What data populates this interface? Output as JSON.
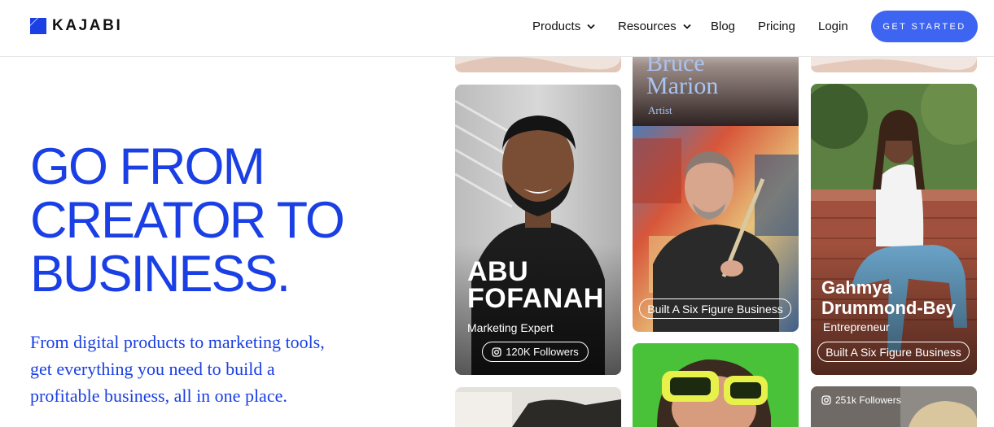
{
  "brand": {
    "name": "KAJABI",
    "color": "#1a3fe4"
  },
  "nav": {
    "items": [
      {
        "label": "Products"
      },
      {
        "label": "Resources"
      },
      {
        "label": "Blog"
      },
      {
        "label": "Pricing"
      },
      {
        "label": "Login"
      }
    ],
    "cta_label": "GET STARTED",
    "cta_color": "#3d65f1"
  },
  "hero": {
    "headline_lines": [
      "GO FROM",
      "CREATOR TO",
      "BUSINESS."
    ],
    "subtext_lines": [
      "From digital products to marketing tools,",
      "get everything you need to build a",
      "profitable business, all in one place."
    ]
  },
  "cards": {
    "abu": {
      "first": "ABU",
      "last": "FOFANAH",
      "role": "Marketing Expert",
      "badge": "120K Followers"
    },
    "bruce": {
      "first": "Bruce",
      "last": "Marion",
      "role": "Artist",
      "badge": "Built A Six Figure Business"
    },
    "gahmya": {
      "first": "Gahmya",
      "last": "Drummond-Bey",
      "role": "Entrepreneur",
      "badge": "Built A Six Figure Business"
    },
    "bottom_right": {
      "badge": "251k Followers"
    }
  },
  "icons": [
    "chevron-down-icon",
    "instagram-icon"
  ]
}
